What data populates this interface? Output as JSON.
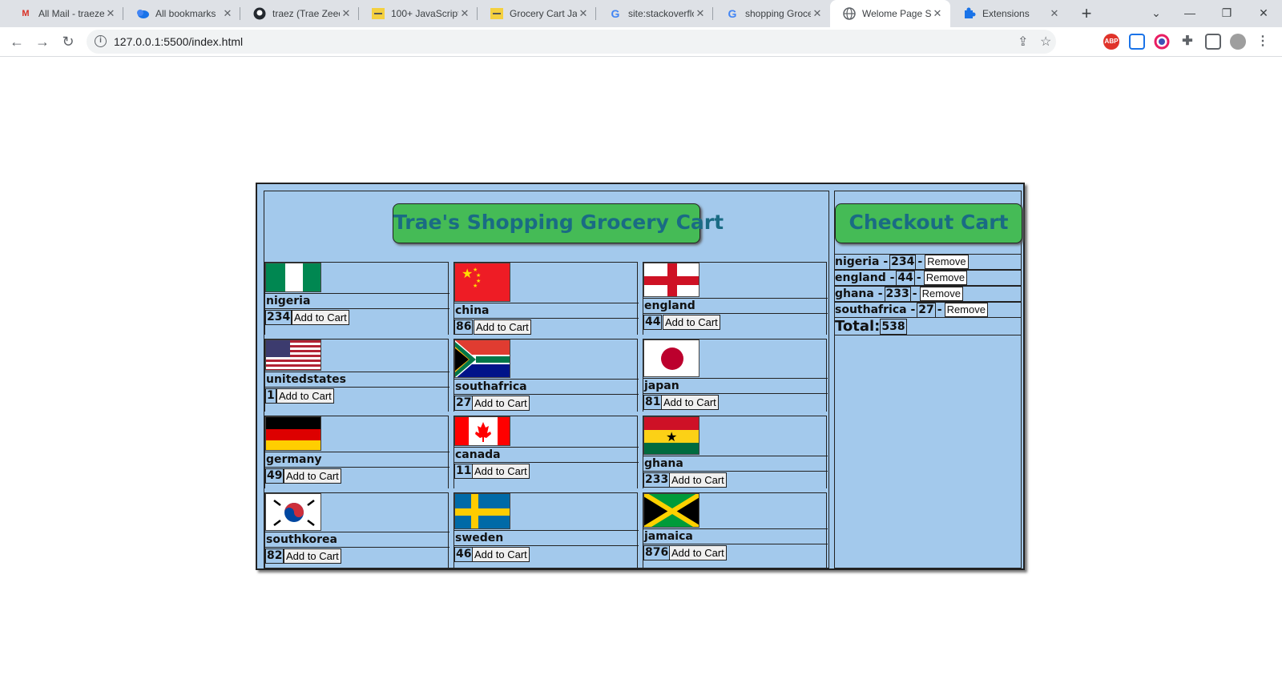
{
  "browser": {
    "tabs": [
      {
        "title": "All Mail - traeze",
        "icon": "gmail-icon"
      },
      {
        "title": "All bookmarks",
        "icon": "bookmarks-icon"
      },
      {
        "title": "traez (Trae Zeeo",
        "icon": "github-icon"
      },
      {
        "title": "100+ JavaScript",
        "icon": "note-icon"
      },
      {
        "title": "Grocery Cart Ja",
        "icon": "note-icon"
      },
      {
        "title": "site:stackoverflo",
        "icon": "google-icon"
      },
      {
        "title": "shopping Groce",
        "icon": "google-icon"
      },
      {
        "title": "Welome Page S",
        "icon": "globe-icon"
      },
      {
        "title": "Extensions",
        "icon": "puzzle-icon"
      }
    ],
    "url": "127.0.0.1:5500/index.html"
  },
  "shop": {
    "title": "Trae's Shopping Grocery Cart",
    "add_label": "Add to Cart",
    "items": [
      {
        "name": "nigeria",
        "price": "234"
      },
      {
        "name": "china",
        "price": "86"
      },
      {
        "name": "england",
        "price": "44"
      },
      {
        "name": "unitedstates",
        "price": "1"
      },
      {
        "name": "southafrica",
        "price": "27"
      },
      {
        "name": "japan",
        "price": "81"
      },
      {
        "name": "germany",
        "price": "49"
      },
      {
        "name": "canada",
        "price": "11"
      },
      {
        "name": "ghana",
        "price": "233"
      },
      {
        "name": "southkorea",
        "price": "82"
      },
      {
        "name": "sweden",
        "price": "46"
      },
      {
        "name": "jamaica",
        "price": "876"
      }
    ]
  },
  "cart": {
    "title": "Checkout Cart",
    "remove_label": "Remove",
    "dash": "-",
    "items": [
      {
        "name": "nigeria",
        "price": "234"
      },
      {
        "name": "england",
        "price": "44"
      },
      {
        "name": "ghana",
        "price": "233"
      },
      {
        "name": "southafrica",
        "price": "27"
      }
    ],
    "total_label": "Total:",
    "total_value": "538"
  },
  "colors": {
    "page_bg": "#a3c9ec",
    "title_button": "#45bb56",
    "title_text": "#1a6b84"
  }
}
